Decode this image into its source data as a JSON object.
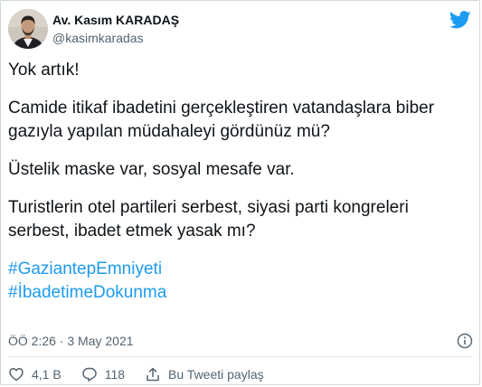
{
  "author": {
    "name": "Av. Kasım KARADAŞ",
    "handle": "@kasimkaradas"
  },
  "tweet": {
    "paragraphs": [
      "Yok artık!",
      "Camide itikaf ibadetini gerçekleştiren vatandaşlara biber gazıyla yapılan müdahaleyi gördünüz mü?",
      "Üstelik maske var, sosyal mesafe var.",
      "Turistlerin otel partileri serbest, siyasi parti kongreleri serbest, ibadet etmek yasak mı?"
    ],
    "hashtags": [
      "#GaziantepEmniyeti",
      "#İbadetimeDokunma"
    ],
    "timestamp": "ÖÖ 2:26 · 3 May 2021"
  },
  "actions": {
    "likes": "4,1 B",
    "replies": "118",
    "share_label": "Bu Tweeti paylaş"
  },
  "colors": {
    "brand": "#1d9bf0",
    "text": "#0f1419",
    "muted": "#536471"
  }
}
